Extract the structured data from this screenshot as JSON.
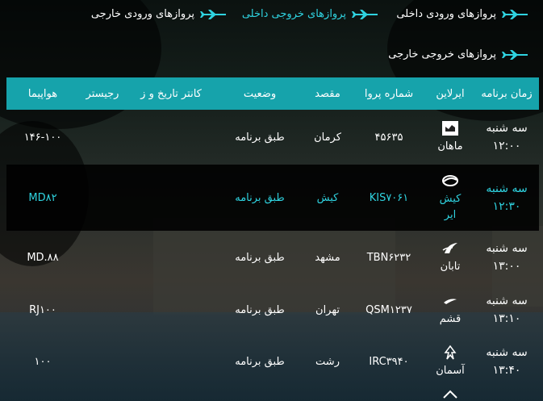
{
  "tabs": [
    {
      "label": "پروازهای ورودی داخلی",
      "active": false
    },
    {
      "label": "پروازهای خروجی داخلی",
      "active": true
    },
    {
      "label": "پروازهای ورودی خارجی",
      "active": false
    },
    {
      "label": "پروازهای خروجی خارجی",
      "active": false
    }
  ],
  "table": {
    "headers": {
      "time": "زمان برنامه",
      "airline": "ایرلاین",
      "flight": "شماره پروا",
      "destination": "مقصد",
      "status": "وضعیت",
      "date": "کانتر تاریخ و ز",
      "register": "رجیستر",
      "aircraft": "هواپیما"
    },
    "rows": [
      {
        "day": "سه شنبه",
        "time": "۱۲:۰۰",
        "airline": "ماهان",
        "flight": "۴۵۶۳۵",
        "destination": "کرمان",
        "status": "طبق برنامه",
        "date": "",
        "register": "",
        "aircraft": "۱۴۶-۱۰۰"
      },
      {
        "day": "سه شنبه",
        "time": "۱۲:۳۰",
        "airline": "کیش ایر",
        "flight": "KIS۷۰۶۱",
        "destination": "کیش",
        "status": "طبق برنامه",
        "date": "",
        "register": "",
        "aircraft": "MD۸۲"
      },
      {
        "day": "سه شنبه",
        "time": "۱۳:۰۰",
        "airline": "تابان",
        "flight": "TBN۶۲۳۲",
        "destination": "مشهد",
        "status": "طبق برنامه",
        "date": "",
        "register": "",
        "aircraft": "MD.۸۸"
      },
      {
        "day": "سه شنبه",
        "time": "۱۳:۱۰",
        "airline": "قشم",
        "flight": "QSM۱۲۳۷",
        "destination": "تهران",
        "status": "طبق برنامه",
        "date": "",
        "register": "",
        "aircraft": "RJ۱۰۰"
      },
      {
        "day": "سه شنبه",
        "time": "۱۳:۴۰",
        "airline": "آسمان",
        "flight": "IRC۳۹۴۰",
        "destination": "رشت",
        "status": "طبق برنامه",
        "date": "",
        "register": "",
        "aircraft": "۱۰۰"
      }
    ]
  },
  "colors": {
    "accent": "#2fd3e0",
    "header_bg": "#16a3ab",
    "dark_row_bg": "#000000"
  },
  "icons": {
    "tab": "plane-icon",
    "airlines": [
      "mahan-logo-icon",
      "kish-air-logo-icon",
      "taban-logo-icon",
      "qeshm-logo-icon",
      "aseman-logo-icon"
    ]
  }
}
